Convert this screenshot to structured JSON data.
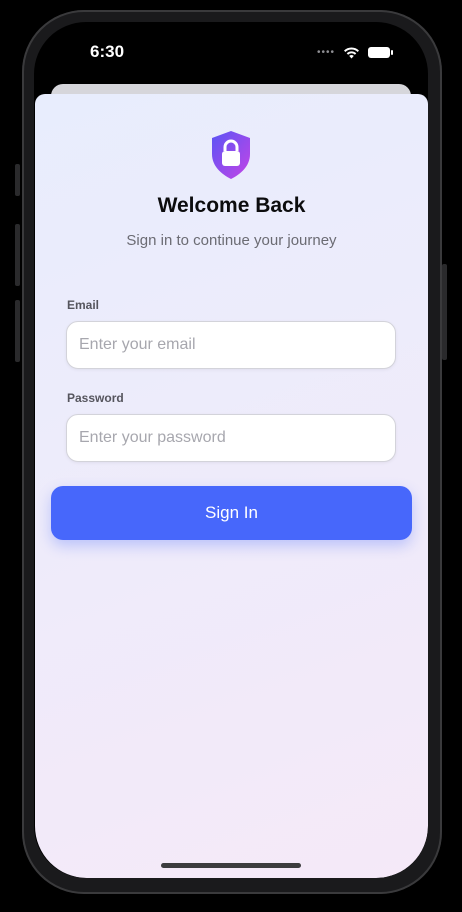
{
  "status_bar": {
    "time": "6:30"
  },
  "login": {
    "title": "Welcome Back",
    "subtitle": "Sign in to continue your journey",
    "email": {
      "label": "Email",
      "value": "",
      "placeholder": "Enter your email"
    },
    "password": {
      "label": "Password",
      "value": "",
      "placeholder": "Enter your password"
    },
    "sign_in_button": "Sign In"
  },
  "colors": {
    "accent": "#4767fb",
    "icon_gradient_start": "#5b54f5",
    "icon_gradient_end": "#c445e6"
  },
  "icons": [
    "lock-shield-icon",
    "wifi-icon",
    "battery-icon",
    "signal-dots-icon"
  ]
}
